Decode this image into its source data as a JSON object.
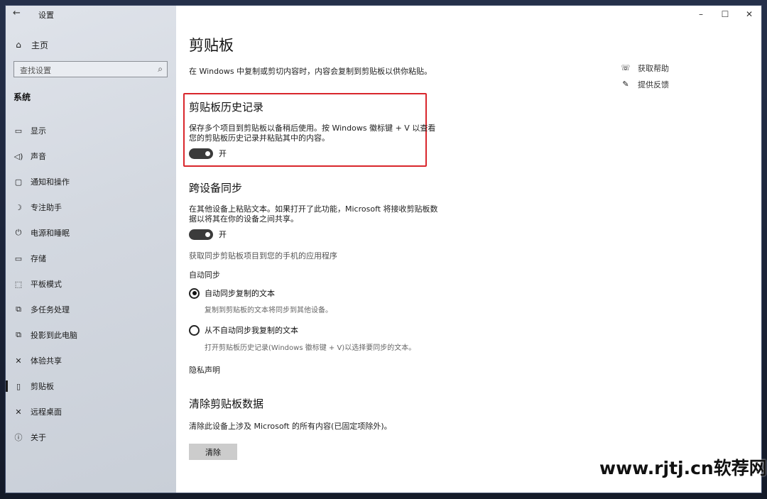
{
  "window": {
    "title": "设置"
  },
  "titlebar": {
    "back_icon": "←",
    "minimize": "–",
    "maximize": "☐",
    "close": "✕"
  },
  "sidebar": {
    "home_label": "主页",
    "search_placeholder": "查找设置",
    "section_label": "系统",
    "items": [
      {
        "label": "显示",
        "icon": "monitor-icon",
        "glyph": "▭"
      },
      {
        "label": "声音",
        "icon": "speaker-icon",
        "glyph": "◁)"
      },
      {
        "label": "通知和操作",
        "icon": "notification-icon",
        "glyph": "▢"
      },
      {
        "label": "专注助手",
        "icon": "moon-icon",
        "glyph": "☽"
      },
      {
        "label": "电源和睡眠",
        "icon": "power-icon",
        "glyph": "⏻"
      },
      {
        "label": "存储",
        "icon": "storage-icon",
        "glyph": "▭"
      },
      {
        "label": "平板模式",
        "icon": "tablet-icon",
        "glyph": "⬚"
      },
      {
        "label": "多任务处理",
        "icon": "multitask-icon",
        "glyph": "⧉"
      },
      {
        "label": "投影到此电脑",
        "icon": "project-icon",
        "glyph": "⧉"
      },
      {
        "label": "体验共享",
        "icon": "share-icon",
        "glyph": "✕"
      },
      {
        "label": "剪贴板",
        "icon": "clipboard-icon",
        "glyph": "▯"
      },
      {
        "label": "远程桌面",
        "icon": "remote-icon",
        "glyph": "✕"
      },
      {
        "label": "关于",
        "icon": "info-icon",
        "glyph": "ⓘ"
      }
    ],
    "active_index": 10
  },
  "main": {
    "title": "剪贴板",
    "intro": "在 Windows 中复制或剪切内容时，内容会复制到剪贴板以供你粘贴。",
    "help": [
      {
        "label": "获取帮助",
        "icon": "help-chat-icon",
        "glyph": "☏"
      },
      {
        "label": "提供反馈",
        "icon": "feedback-icon",
        "glyph": "✎"
      }
    ],
    "history": {
      "heading": "剪贴板历史记录",
      "desc_line1": "保存多个项目到剪贴板以备稍后使用。按 Windows 徽标键 + V 以查看",
      "desc_line2": "您的剪贴板历史记录并粘贴其中的内容。",
      "toggle_label": "开",
      "toggle_on": true
    },
    "sync": {
      "heading": "跨设备同步",
      "desc_line1": "在其他设备上粘贴文本。如果打开了此功能，Microsoft 将接收剪贴板数",
      "desc_line2": "据以将其在你的设备之间共享。",
      "toggle_label": "开",
      "toggle_on": true,
      "app_link": "获取同步剪贴板项目到您的手机的应用程序",
      "auto_sync_label": "自动同步",
      "options": [
        {
          "label": "自动同步复制的文本",
          "sub": "复制到剪贴板的文本将同步到其他设备。",
          "checked": true
        },
        {
          "label": "从不自动同步我复制的文本",
          "sub": "打开剪贴板历史记录(Windows 徽标键 + V)以选择要同步的文本。",
          "checked": false
        }
      ],
      "privacy": "隐私声明"
    },
    "clear": {
      "heading": "清除剪贴板数据",
      "desc": "清除此设备上涉及 Microsoft 的所有内容(已固定项除外)。",
      "button": "清除"
    }
  },
  "watermark": "www.rjtj.cn软荐网"
}
